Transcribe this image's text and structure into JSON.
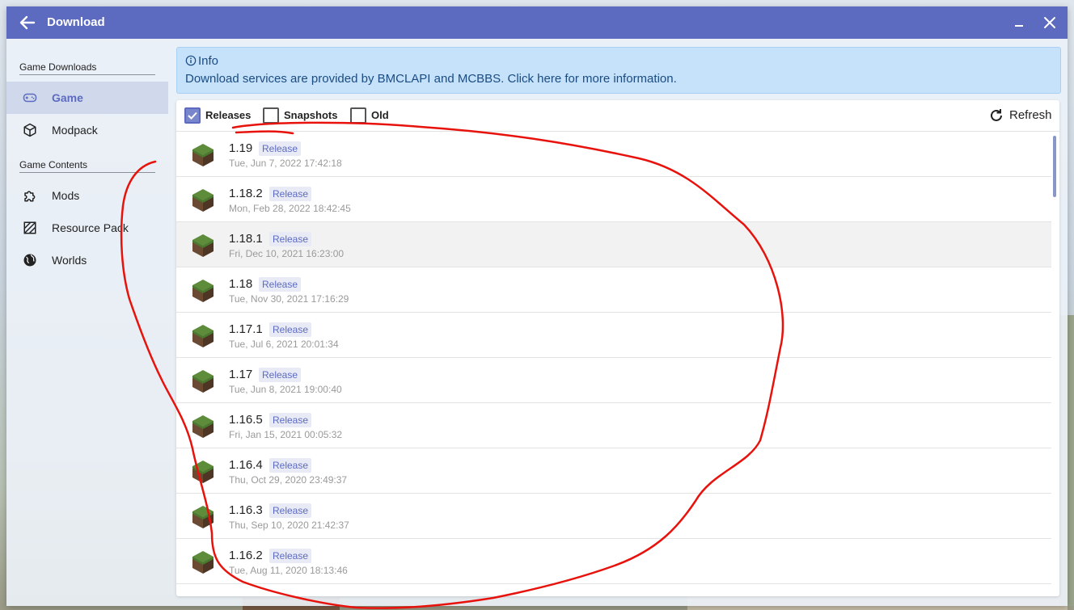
{
  "window": {
    "title": "Download"
  },
  "sidebar": {
    "sections": [
      {
        "title": "Game Downloads",
        "items": [
          {
            "label": "Game",
            "active": true,
            "icon": "gamepad-icon"
          },
          {
            "label": "Modpack",
            "icon": "cube-icon"
          }
        ]
      },
      {
        "title": "Game Contents",
        "items": [
          {
            "label": "Mods",
            "icon": "puzzle-icon"
          },
          {
            "label": "Resource Pack",
            "icon": "texture-icon"
          },
          {
            "label": "Worlds",
            "icon": "globe-icon"
          }
        ]
      }
    ]
  },
  "info": {
    "title": "Info",
    "text": "Download services are provided by BMCLAPI and MCBBS. Click here for more information."
  },
  "filters": [
    {
      "label": "Releases",
      "checked": true
    },
    {
      "label": "Snapshots",
      "checked": false
    },
    {
      "label": "Old",
      "checked": false
    }
  ],
  "refresh_label": "Refresh",
  "versions": [
    {
      "version": "1.19",
      "type": "Release",
      "date": "Tue, Jun 7, 2022 17:42:18"
    },
    {
      "version": "1.18.2",
      "type": "Release",
      "date": "Mon, Feb 28, 2022 18:42:45"
    },
    {
      "version": "1.18.1",
      "type": "Release",
      "date": "Fri, Dec 10, 2021 16:23:00"
    },
    {
      "version": "1.18",
      "type": "Release",
      "date": "Tue, Nov 30, 2021 17:16:29"
    },
    {
      "version": "1.17.1",
      "type": "Release",
      "date": "Tue, Jul 6, 2021 20:01:34"
    },
    {
      "version": "1.17",
      "type": "Release",
      "date": "Tue, Jun 8, 2021 19:00:40"
    },
    {
      "version": "1.16.5",
      "type": "Release",
      "date": "Fri, Jan 15, 2021 00:05:32"
    },
    {
      "version": "1.16.4",
      "type": "Release",
      "date": "Thu, Oct 29, 2020 23:49:37"
    },
    {
      "version": "1.16.3",
      "type": "Release",
      "date": "Thu, Sep 10, 2020 21:42:37"
    },
    {
      "version": "1.16.2",
      "type": "Release",
      "date": "Tue, Aug 11, 2020 18:13:46"
    }
  ],
  "colors": {
    "accent": "#5c6bc0",
    "info_bg": "#c6e2fb",
    "annotation": "#e8120c"
  }
}
